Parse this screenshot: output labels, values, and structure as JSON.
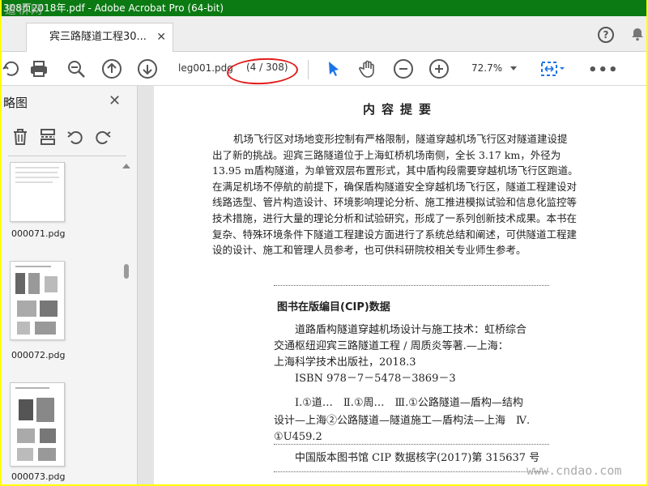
{
  "window": {
    "title": "308页2018年.pdf - Adobe Acrobat Pro (64-bit)",
    "watermark_top": "道桥网",
    "watermark_bottom": "www.cndao.com"
  },
  "tabs": [
    {
      "label": "宾三路隧道工程30...",
      "close": "✕"
    }
  ],
  "header": {
    "help_label": "?"
  },
  "toolbar": {
    "page_field_value": "leg001.pdg",
    "page_count": "(4 / 308)",
    "zoom_value": "72.7%",
    "more_label": "•••",
    "icons": [
      "rotate-icon",
      "print-icon",
      "zoom-out-search-icon",
      "page-up-icon",
      "page-down-icon",
      "select-arrow-icon",
      "hand-icon",
      "zoom-out-icon",
      "zoom-in-icon",
      "fit-page-icon",
      "more-icon"
    ],
    "accent_color": "#1a73e8"
  },
  "sidebar": {
    "title": "略图",
    "close": "✕",
    "thumbnails": [
      {
        "label": "000071.pdg"
      },
      {
        "label": "000072.pdg"
      },
      {
        "label": "000073.pdg"
      }
    ]
  },
  "document": {
    "heading": "内容提要",
    "abstract_lines": [
      "机场飞行区对场地变形控制有严格限制，隧道穿越机场飞行区对隧道建设提",
      "出了新的挑战。迎宾三路隧道位于上海虹桥机场南侧，全长 3.17 km，外径为",
      "13.95 m盾构隧道，为单管双层布置形式，其中盾构段需要穿越机场飞行区跑道。",
      "在满足机场不停航的前提下，确保盾构隧道安全穿越机场飞行区，隧道工程建设对",
      "线路选型、管片构造设计、环境影响理论分析、施工推进模拟试验和信息化监控等",
      "技术措施，进行大量的理论分析和试验研究，形成了一系列创新技术成果。本书在",
      "复杂、特殊环境条件下隧道工程建设方面进行了系统总结和阐述，可供隧道工程建",
      "设的设计、施工和管理人员参考，也可供科研院校相关专业师生参考。"
    ],
    "cip_title": "图书在版编目(CIP)数据",
    "cip_lines": [
      "道路盾构隧道穿越机场设计与施工技术：虹桥综合",
      "交通枢纽迎宾三路隧道工程 / 周质炎等著.—上海：",
      "上海科学技术出版社，2018.3",
      "ISBN 978－7－5478－3869－3"
    ],
    "classification_lines": [
      "Ⅰ.①道…　Ⅱ.①周…　Ⅲ.①公路隧道—盾构—结构",
      "设计—上海②公路隧道—隧道施工—盾构法—上海　Ⅳ.",
      "①U459.2"
    ],
    "cip_number": "中国版本图书馆 CIP 数据核字(2017)第 315637 号"
  },
  "colors": {
    "titlebar": "#0b7a13",
    "highlight": "#e31c1c",
    "border": "#ffff00"
  }
}
